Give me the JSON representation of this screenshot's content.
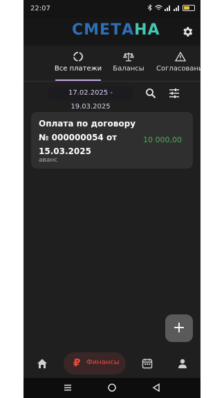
{
  "status_bar": {
    "time": "22:07",
    "battery_level": 0.6
  },
  "header": {
    "logo_part1": "СМЕТА",
    "logo_part2": "НА",
    "settings_icon": "gear-icon"
  },
  "tabs": [
    {
      "label": "Все платежи",
      "icon": "circle-arrows-icon",
      "active": true
    },
    {
      "label": "Балансы",
      "icon": "scales-icon",
      "active": false
    },
    {
      "label": "Согласовани",
      "icon": "warning-triangle-icon",
      "active": false
    }
  ],
  "filter": {
    "date_range": "17.02.2025 - 19.03.2025"
  },
  "payments": [
    {
      "title": "Оплата по договору № 000000054 от 15.03.2025",
      "amount": "10 000,00",
      "note": "аванс"
    }
  ],
  "fab": {
    "label": "+"
  },
  "bottom_nav": {
    "finance_label": "Финансы",
    "finance_symbol": "₽",
    "items": [
      "home-icon",
      "ruble-icon",
      "calendar-icon",
      "person-icon"
    ]
  },
  "colors": {
    "amount": "#4caf50",
    "finance_active": "#e74c3c",
    "tab_underline": "#c8a6e8"
  }
}
